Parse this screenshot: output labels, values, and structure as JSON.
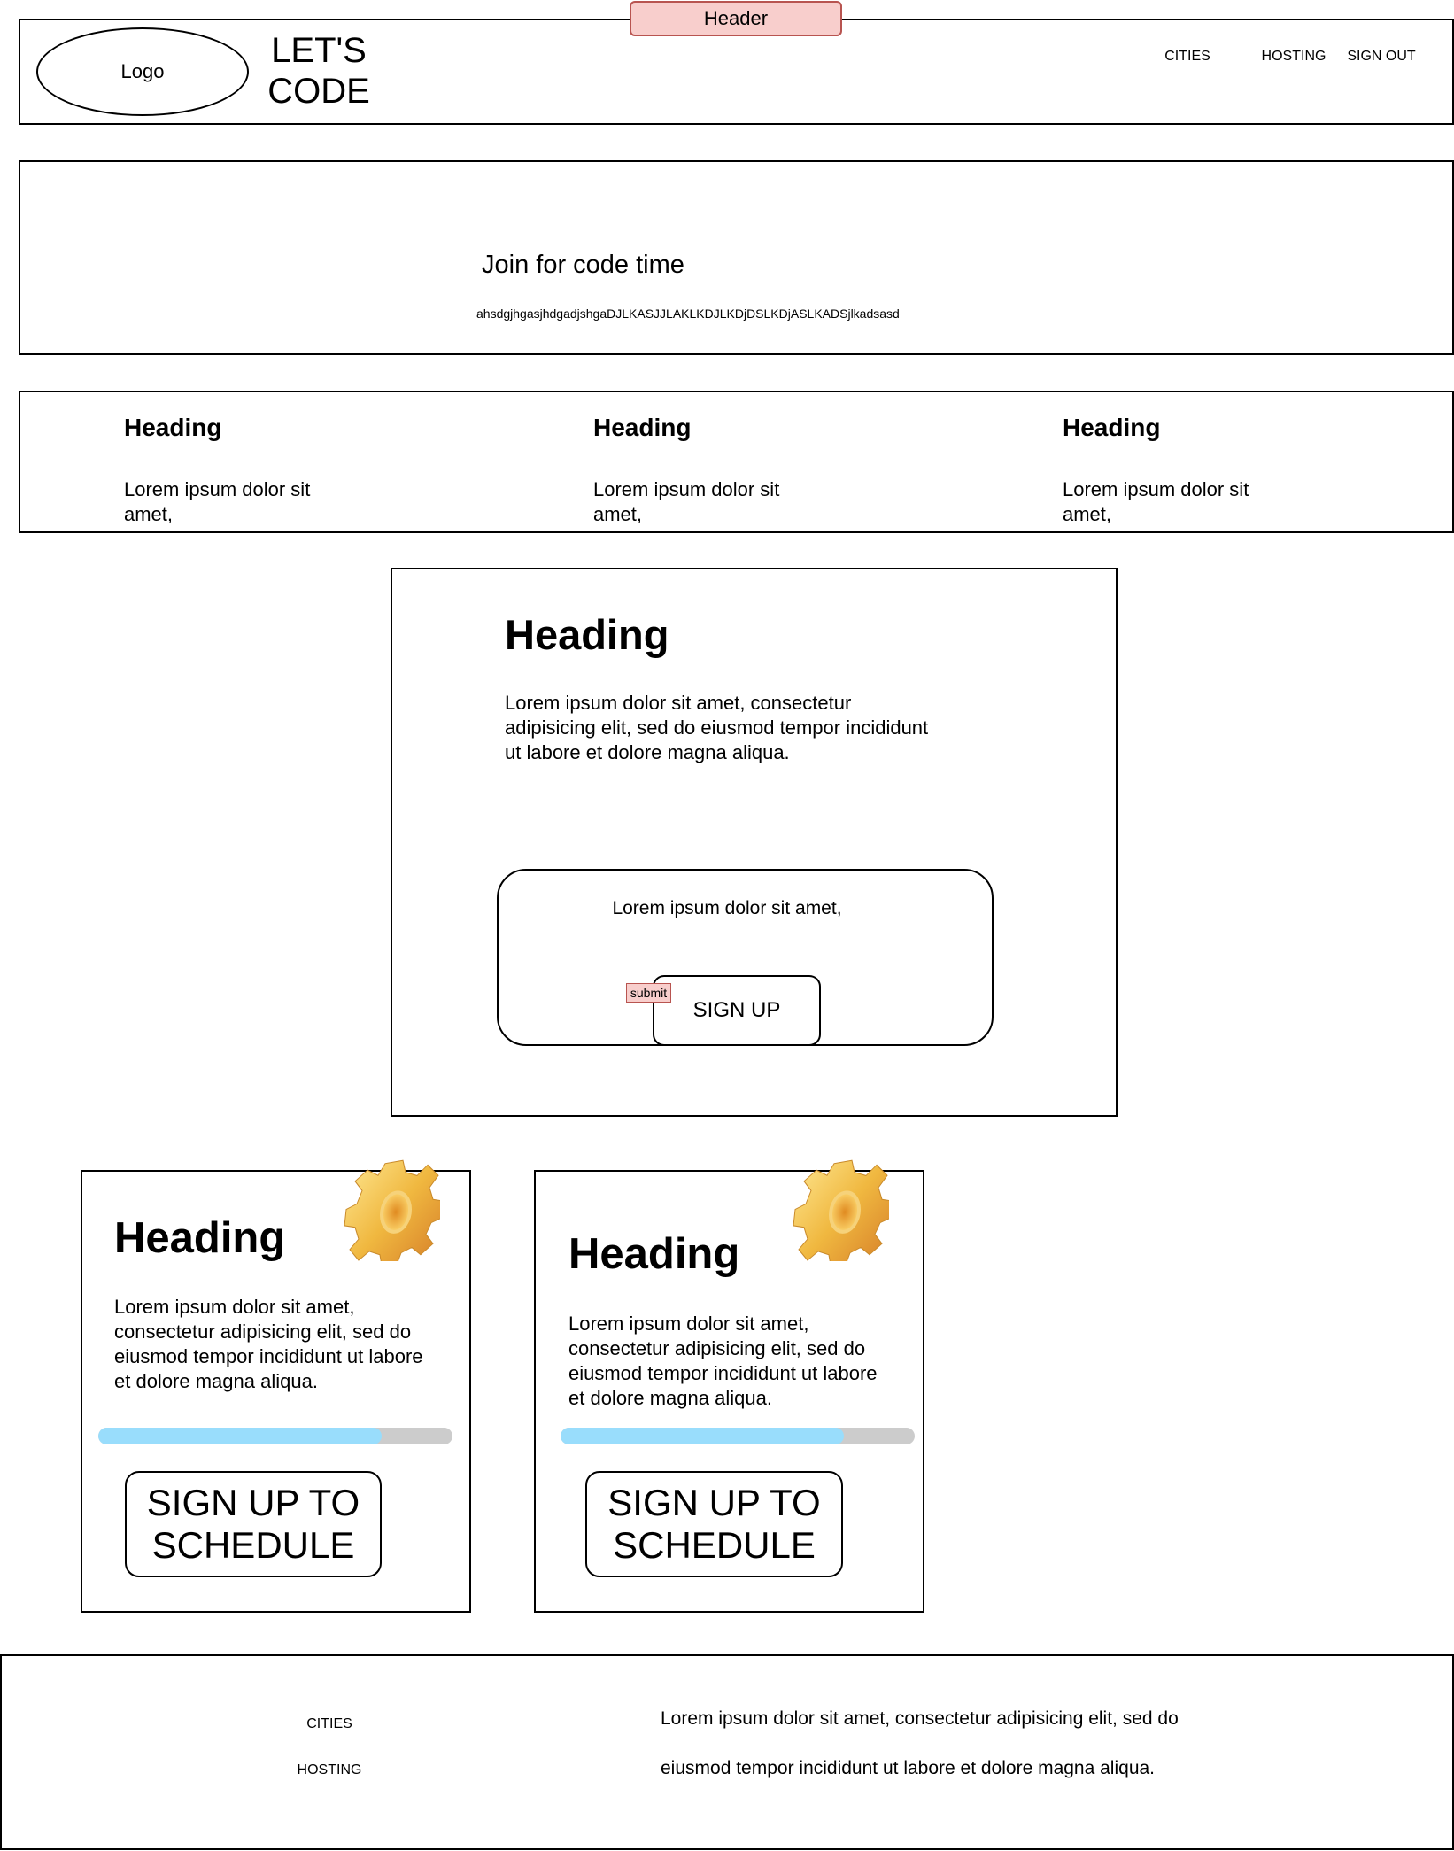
{
  "header": {
    "tag_label": "Header",
    "logo_label": "Logo",
    "brand_line1": "LET'S",
    "brand_line2": "CODE",
    "nav": [
      {
        "label": "CITIES"
      },
      {
        "label": "HOSTING"
      },
      {
        "label": "SIGN OUT"
      }
    ]
  },
  "hero": {
    "title": "Join for code time",
    "subtitle": "ahsdgjhgasjhdgadjshgaDJLKASJJLAKLKDJLKDjDSLKDjASLKADSjlkadsasd"
  },
  "features": [
    {
      "heading": "Heading",
      "text": "Lorem ipsum dolor sit amet,"
    },
    {
      "heading": "Heading",
      "text": "Lorem ipsum dolor sit amet,"
    },
    {
      "heading": "Heading",
      "text": "Lorem ipsum dolor sit amet,"
    }
  ],
  "signup_section": {
    "heading": "Heading",
    "text": "Lorem ipsum dolor sit amet, consectetur adipisicing elit, sed do eiusmod tempor incididunt ut labore et dolore magna aliqua.",
    "form_text": "Lorem ipsum dolor sit amet,",
    "submit_tag": "submit",
    "button_label": "SIGN UP"
  },
  "cards": [
    {
      "heading": "Heading",
      "text": "Lorem ipsum dolor sit amet, consectetur adipisicing elit, sed do eiusmod tempor incididunt ut labore et dolore magna aliqua.",
      "progress": 0.8,
      "button_line1": "SIGN UP TO",
      "button_line2": "SCHEDULE",
      "icon": "gear-icon"
    },
    {
      "heading": "Heading",
      "text": "Lorem ipsum dolor sit amet, consectetur adipisicing elit, sed do eiusmod tempor incididunt ut labore et dolore magna aliqua.",
      "progress": 0.8,
      "button_line1": "SIGN UP TO",
      "button_line2": "SCHEDULE",
      "icon": "gear-icon"
    }
  ],
  "footer": {
    "links": [
      {
        "label": "CITIES"
      },
      {
        "label": "HOSTING"
      }
    ],
    "text": "Lorem ipsum dolor sit amet, consectetur adipisicing elit, sed do eiusmod tempor incididunt ut labore et dolore magna aliqua."
  },
  "colors": {
    "progress_fill": "#99ddfc",
    "progress_track": "#cccccc",
    "tag_fill": "#f8cecc",
    "tag_border": "#b85450"
  }
}
